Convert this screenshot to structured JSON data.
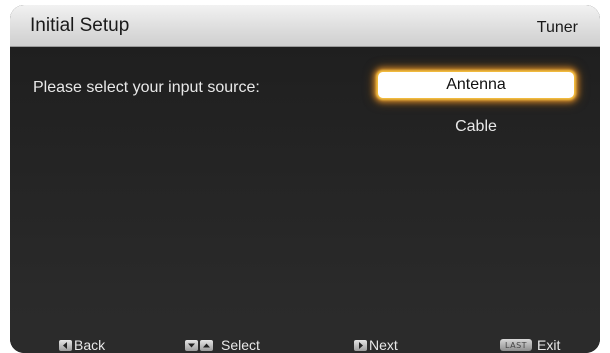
{
  "header": {
    "title": "Initial Setup",
    "context": "Tuner"
  },
  "main": {
    "prompt": "Please select your input source:",
    "options": [
      {
        "label": "Antenna",
        "selected": true
      },
      {
        "label": "Cable",
        "selected": false
      }
    ]
  },
  "footer": {
    "hints": [
      {
        "key_icon": "left-arrow-key-icon",
        "label": "Back"
      },
      {
        "key_icon": "down-up-arrow-keys-icon",
        "label": "Select"
      },
      {
        "key_icon": "right-arrow-key-icon",
        "label": "Next"
      },
      {
        "key_icon": "last-key-icon",
        "key_text": "LAST",
        "label": "Exit"
      }
    ]
  },
  "colors": {
    "header_bg": "#dcdcdc",
    "content_bg": "#262626",
    "footer_bg": "#2b2b2b",
    "focus_glow": "#e8a030",
    "text_light": "#e8e8e8"
  }
}
